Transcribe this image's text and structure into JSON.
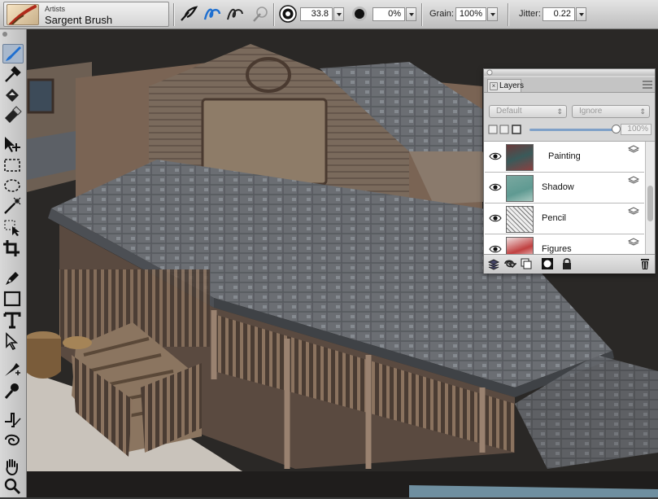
{
  "brush": {
    "category": "Artists",
    "name": "Sargent Brush"
  },
  "propbar": {
    "size_value": "33.8",
    "opacity_value": "0%",
    "grain_label": "Grain:",
    "grain_value": "100%",
    "jitter_label": "Jitter:",
    "jitter_value": "0.22"
  },
  "layers_panel": {
    "tab_label": "Layers",
    "composite_method": "Default",
    "composite_depth": "Ignore",
    "opacity_value": "100%",
    "opacity_fraction": 1.0,
    "layers": [
      {
        "name": "Painting"
      },
      {
        "name": "Shadow"
      },
      {
        "name": "Pencil"
      },
      {
        "name": "Figures"
      }
    ]
  },
  "colors": {
    "selected_tool": "#a8b8cc",
    "tool_icon": "#1e6fd0",
    "panel_bg": "#d6d6d6"
  },
  "icons": {
    "toolbox": [
      "brush-icon",
      "dropper-icon",
      "paint-bucket-icon",
      "eraser-icon",
      "layer-adjuster-icon",
      "rectangle-select-icon",
      "lasso-icon",
      "magic-wand-icon",
      "transform-icon",
      "crop-icon",
      "pen-icon",
      "rectangle-shape-icon",
      "text-icon",
      "shape-selection-icon",
      "cloner-icon",
      "rubber-stamp-icon",
      "dodge-icon",
      "burn-icon",
      "grabber-icon",
      "magnifier-icon"
    ]
  }
}
